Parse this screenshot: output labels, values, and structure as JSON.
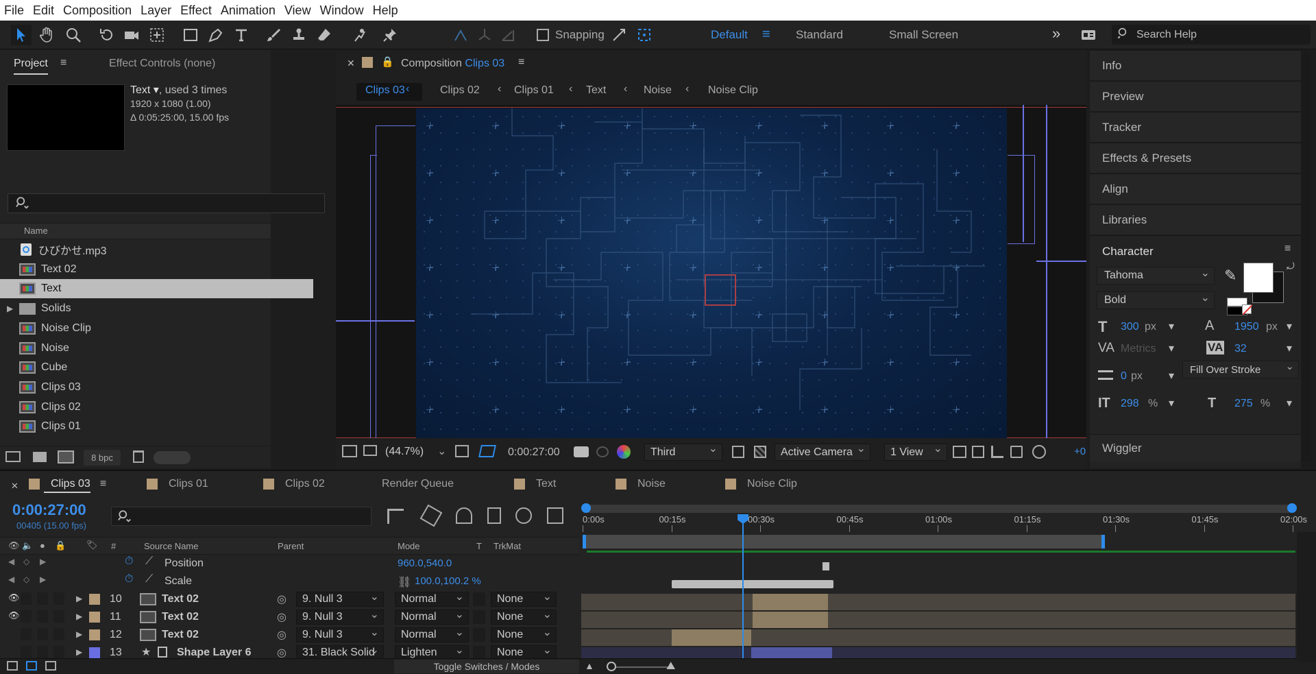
{
  "menu": [
    "File",
    "Edit",
    "Composition",
    "Layer",
    "Effect",
    "Animation",
    "View",
    "Window",
    "Help"
  ],
  "toolbar": {
    "snapping_label": "Snapping",
    "workspaces": [
      "Default",
      "Standard",
      "Small Screen"
    ],
    "active_workspace": "Default",
    "search_placeholder": "Search Help"
  },
  "project_panel": {
    "tab_project": "Project",
    "tab_effect_controls": "Effect Controls (none)",
    "selected_name": "Text",
    "used_text": ", used 3 times",
    "dimensions": "1920 x 1080 (1.00)",
    "duration": "Δ 0:05:25:00, 15.00 fps",
    "column_name": "Name",
    "items": [
      {
        "name": "ひびかせ.mp3",
        "type": "audio"
      },
      {
        "name": "Text 02",
        "type": "comp"
      },
      {
        "name": "Text",
        "type": "comp",
        "selected": true
      },
      {
        "name": "Solids",
        "type": "folder"
      },
      {
        "name": "Noise Clip",
        "type": "comp"
      },
      {
        "name": "Noise",
        "type": "comp"
      },
      {
        "name": "Cube",
        "type": "comp"
      },
      {
        "name": "Clips 03",
        "type": "comp"
      },
      {
        "name": "Clips 02",
        "type": "comp"
      },
      {
        "name": "Clips 01",
        "type": "comp"
      }
    ],
    "bpc": "8 bpc"
  },
  "composition_panel": {
    "title_prefix": "Composition",
    "title_comp": "Clips 03",
    "breadcrumbs": [
      "Clips 03",
      "Clips 02",
      "Clips 01",
      "Text",
      "Noise",
      "Noise Clip"
    ],
    "zoom": "(44.7%)",
    "timecode": "0:00:27:00",
    "resolution": "Third",
    "camera": "Active Camera",
    "views": "1 View",
    "offset": "+0"
  },
  "right_panel": {
    "items": [
      "Info",
      "Preview",
      "Tracker",
      "Effects & Presets",
      "Align",
      "Libraries"
    ],
    "character_title": "Character",
    "font_family": "Tahoma",
    "font_style": "Bold",
    "font_size_value": "300",
    "font_size_unit": "px",
    "leading_value": "1950",
    "leading_unit": "px",
    "kerning": "Metrics",
    "tracking": "32",
    "stroke_width_value": "0",
    "stroke_width_unit": "px",
    "stroke_type": "Fill Over Stroke",
    "vert_scale_value": "298",
    "vert_scale_unit": "%",
    "horiz_scale_value": "275",
    "horiz_scale_unit": "%",
    "wiggler": "Wiggler",
    "fill_color": "#ffffff"
  },
  "timeline": {
    "tabs": [
      "Clips 03",
      "Clips 01",
      "Clips 02",
      "Render Queue",
      "Text",
      "Noise",
      "Noise Clip"
    ],
    "active_tab": "Clips 03",
    "timecode": "0:00:27:00",
    "frame_info": "00405 (15.00 fps)",
    "ruler_labels": [
      "0:00s",
      "00:15s",
      "00:30s",
      "00:45s",
      "01:00s",
      "01:15s",
      "01:30s",
      "01:45s",
      "02:00s"
    ],
    "playhead_fraction": 0.225,
    "columns": {
      "source": "Source Name",
      "parent": "Parent",
      "mode": "Mode",
      "t": "T",
      "trkmat": "TrkMat"
    },
    "properties": [
      {
        "name": "Position",
        "value": "960.0,540.0"
      },
      {
        "name": "Scale",
        "value": "100.0,100.2 %"
      }
    ],
    "layers": [
      {
        "num": "10",
        "name": "Text 02",
        "parent": "9. Null 3",
        "mode": "Normal",
        "trkmat": "None",
        "visible": true,
        "label": "#b59b78"
      },
      {
        "num": "11",
        "name": "Text 02",
        "parent": "9. Null 3",
        "mode": "Normal",
        "trkmat": "None",
        "visible": true,
        "label": "#b59b78"
      },
      {
        "num": "12",
        "name": "Text 02",
        "parent": "9. Null 3",
        "mode": "Normal",
        "trkmat": "None",
        "visible": false,
        "label": "#b59b78"
      },
      {
        "num": "13",
        "name": "Shape Layer 6",
        "parent": "31. Black Solid",
        "mode": "Lighten",
        "trkmat": "None",
        "visible": false,
        "label": "#6a6ee0"
      }
    ],
    "toggle_label": "Toggle Switches / Modes"
  },
  "colors": {
    "accent": "#2d8ceb",
    "panel": "#232323",
    "bg": "#1d1d1d",
    "selection": "#b8b8b8",
    "comp_bg": "#0c1d36"
  }
}
